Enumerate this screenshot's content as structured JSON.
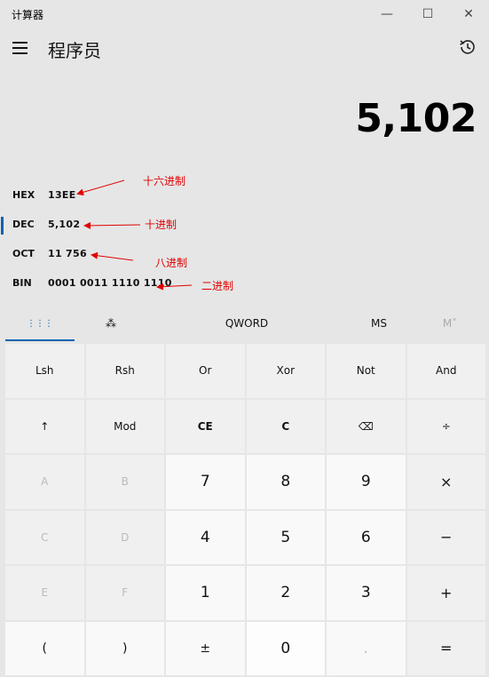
{
  "window": {
    "title": "计算器",
    "minimize": "—",
    "maximize": "☐",
    "close": "✕"
  },
  "header": {
    "mode": "程序员"
  },
  "display": {
    "value": "5,102"
  },
  "radix": [
    {
      "label": "HEX",
      "value": "13EE",
      "active": false
    },
    {
      "label": "DEC",
      "value": "5,102",
      "active": true
    },
    {
      "label": "OCT",
      "value": "11 756",
      "active": false
    },
    {
      "label": "BIN",
      "value": "0001 0011 1110 1110",
      "active": false
    }
  ],
  "annotations": {
    "hex": "十六进制",
    "dec": "十进制",
    "oct": "八进制",
    "bin": "二进制"
  },
  "tabs": {
    "keypad_icon": "⋮⋮⋮",
    "bitflip_icon": "⁂",
    "word": "QWORD",
    "ms": "MS",
    "mr": "M˅"
  },
  "keys": [
    [
      "Lsh",
      "Rsh",
      "Or",
      "Xor",
      "Not",
      "And"
    ],
    [
      "↑",
      "Mod",
      "CE",
      "C",
      "⌫",
      "÷"
    ],
    [
      "A",
      "B",
      "7",
      "8",
      "9",
      "×"
    ],
    [
      "C",
      "D",
      "4",
      "5",
      "6",
      "−"
    ],
    [
      "E",
      "F",
      "1",
      "2",
      "3",
      "+"
    ],
    [
      "(",
      ")",
      "±",
      "0",
      ".",
      "="
    ]
  ],
  "colors": {
    "accent": "#0063b1",
    "annotation": "#e00000"
  }
}
